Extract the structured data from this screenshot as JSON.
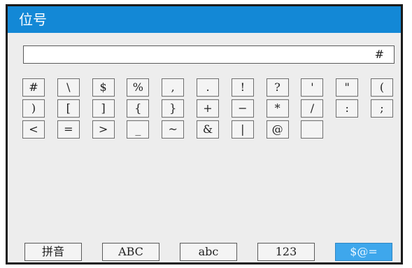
{
  "title": "位号",
  "input_value": "#",
  "keys": [
    "#",
    "\\",
    "$",
    "%",
    ",",
    ".",
    "!",
    "?",
    "'",
    "\"",
    "(",
    ")",
    "[",
    "]",
    "{",
    "}",
    "+",
    "−",
    "*",
    "/",
    ":",
    ";",
    "<",
    "=",
    ">",
    "_",
    "~",
    "&",
    "|",
    "@",
    ""
  ],
  "modes": [
    "拼音",
    "ABC",
    "abc",
    "123",
    "$@="
  ],
  "active_mode": "$@=",
  "colors": {
    "title_bar": "#1388d6",
    "active_mode": "#3ea7ec",
    "panel": "#ededed"
  }
}
